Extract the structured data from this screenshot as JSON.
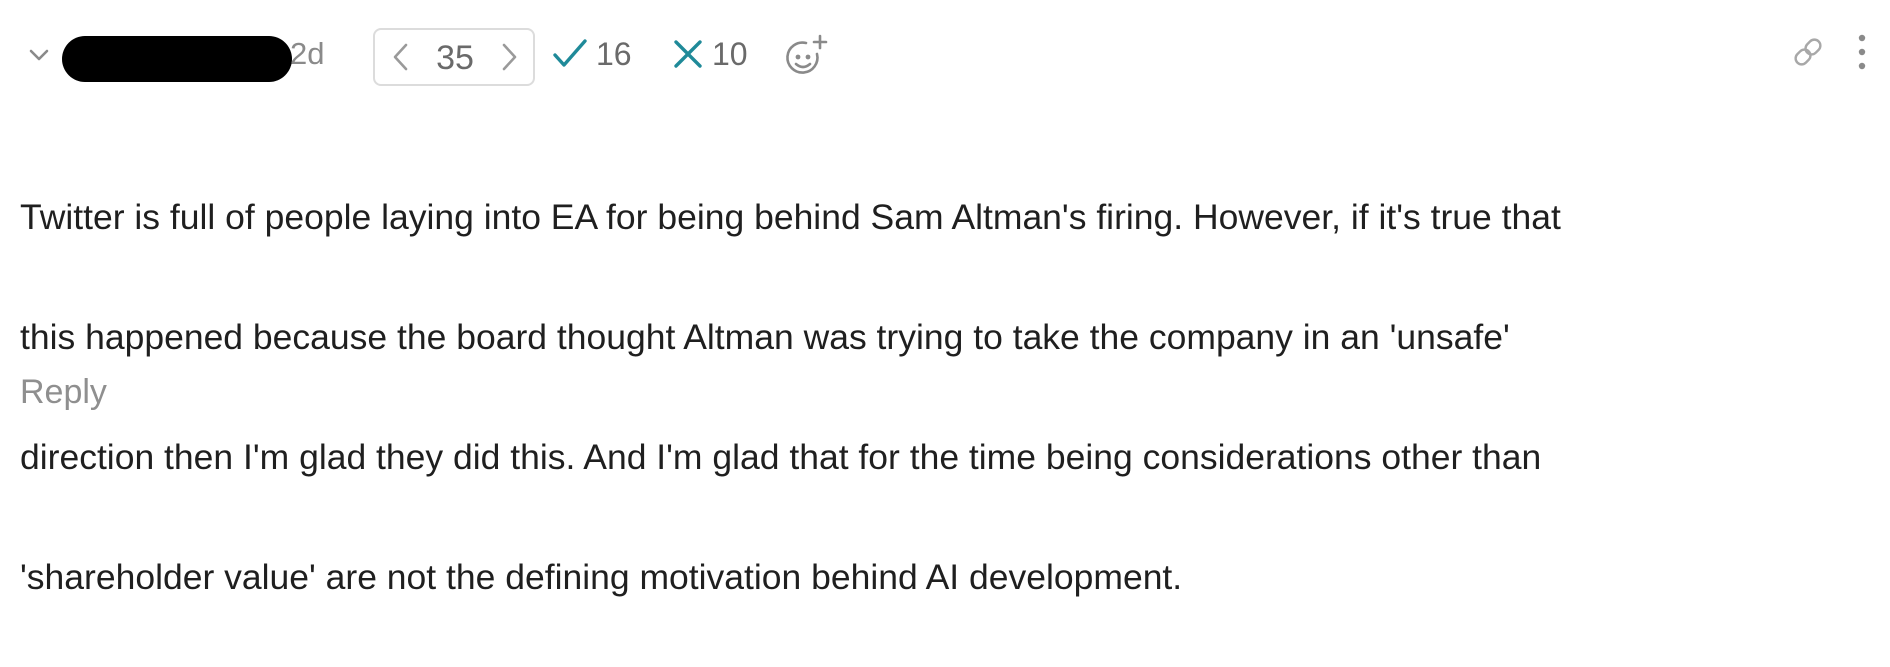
{
  "comment": {
    "timestamp": "2d",
    "karma": "35",
    "agree_count": "16",
    "disagree_count": "10",
    "body_lines": [
      "Twitter is full of people laying into EA for being behind Sam Altman's firing. However, if it's true that",
      "this happened because the board thought Altman was trying to take the company in an 'unsafe'",
      "direction then I'm glad they did this. And I'm glad that for the time being considerations other than",
      "'shareholder value' are not the defining motivation behind AI development."
    ],
    "reply_label": "Reply"
  },
  "colors": {
    "accent_teal": "#1f8a99",
    "muted_text": "#8a8a8a",
    "border": "#dcdcdc"
  },
  "icons": {
    "collapse": "chevron-down-icon",
    "vote_down": "chevron-left-icon",
    "vote_up": "chevron-right-icon",
    "agree": "checkmark-icon",
    "disagree": "x-mark-icon",
    "react": "add-reaction-icon",
    "link": "link-icon",
    "more": "more-vertical-icon"
  }
}
